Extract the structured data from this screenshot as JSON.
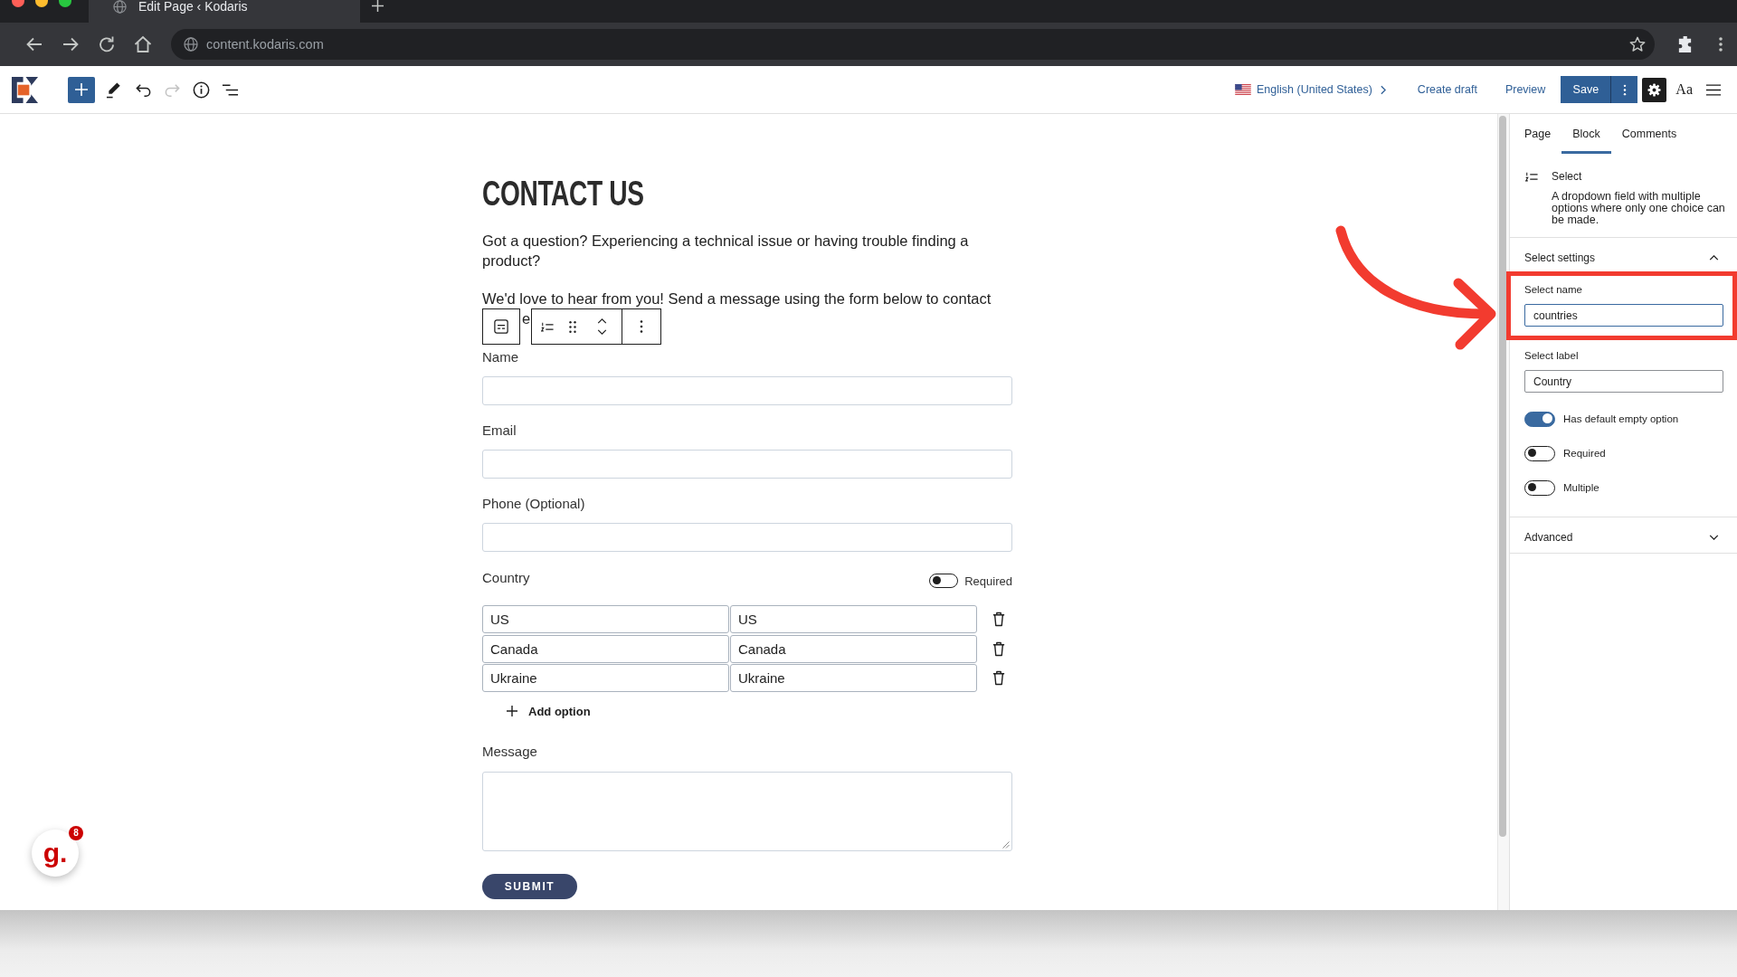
{
  "browser": {
    "tab_title": "Edit Page ‹ Kodaris",
    "url": "content.kodaris.com"
  },
  "toolbar": {
    "tools": [
      {
        "kind": "add",
        "disabled": false
      },
      {
        "kind": "edit",
        "disabled": false
      },
      {
        "kind": "undo",
        "disabled": false
      },
      {
        "kind": "redo",
        "disabled": true
      },
      {
        "kind": "info",
        "disabled": false
      },
      {
        "kind": "outline",
        "disabled": false
      }
    ],
    "language": "English (United States)",
    "links": [
      "Create draft",
      "Preview"
    ],
    "save": "Save",
    "settings_selected": true,
    "typography": "Aa"
  },
  "page": {
    "title": "CONTACT US",
    "intro": "Got a question? Experiencing a technical issue or having trouble finding a product?",
    "intro_2_line_1": "We'd love to hear from you! Send a message using the form below to contact",
    "intro_2_fragment": "e"
  },
  "block_toolbar": {
    "tools": [
      {
        "kind": "block_type"
      },
      {
        "kind": "list"
      },
      {
        "kind": "drag"
      },
      {
        "kind": "move"
      },
      {
        "kind": "more"
      }
    ]
  },
  "form": {
    "fields": [
      {
        "kind": "text",
        "label": "Name"
      },
      {
        "kind": "text",
        "label": "Email"
      },
      {
        "kind": "text",
        "label": "Phone (Optional)"
      },
      {
        "kind": "select",
        "label": "Country",
        "required": false,
        "required_label": "Required",
        "options": [
          {
            "cells": [
              "US",
              "US"
            ]
          },
          {
            "cells": [
              "Canada",
              "Canada"
            ]
          },
          {
            "cells": [
              "Ukraine",
              "Ukraine"
            ]
          }
        ],
        "add_label": "Add option"
      },
      {
        "kind": "textarea",
        "label": "Message"
      }
    ],
    "submit": "SUBMIT"
  },
  "sidebar": {
    "tabs": [
      {
        "label": "Page",
        "selected": false
      },
      {
        "label": "Block",
        "selected": true
      },
      {
        "label": "Comments",
        "selected": false
      }
    ],
    "block": {
      "name": "Select",
      "description": "A dropdown field with multiple options where only one choice can be made."
    },
    "sections": [
      {
        "title": "Select settings",
        "expanded": true,
        "fields": [
          {
            "label": "Select name",
            "value": "countries",
            "focused": true
          },
          {
            "label": "Select label",
            "value": "Country",
            "focused": false
          }
        ],
        "toggles": [
          {
            "label": "Has default empty option",
            "on": true
          },
          {
            "label": "Required",
            "on": false
          },
          {
            "label": "Multiple",
            "on": false
          }
        ]
      },
      {
        "title": "Advanced",
        "expanded": false
      }
    ]
  },
  "help_widget": {
    "logo": "g.",
    "badge": "8"
  }
}
